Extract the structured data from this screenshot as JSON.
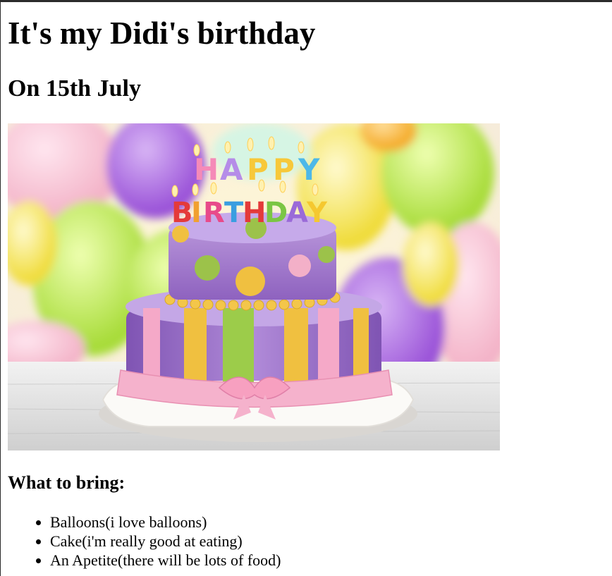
{
  "heading": "It's my Didi's birthday",
  "subheading": "On 15th July",
  "photo": {
    "candle_letters_top": "HAPPY",
    "candle_letters_bottom": "BIRTHDAY"
  },
  "bring_heading": "What to bring:",
  "bring_items": [
    "Balloons(i love balloons)",
    "Cake(i'm really good at eating)",
    "An Apetite(there will be lots of food)"
  ]
}
